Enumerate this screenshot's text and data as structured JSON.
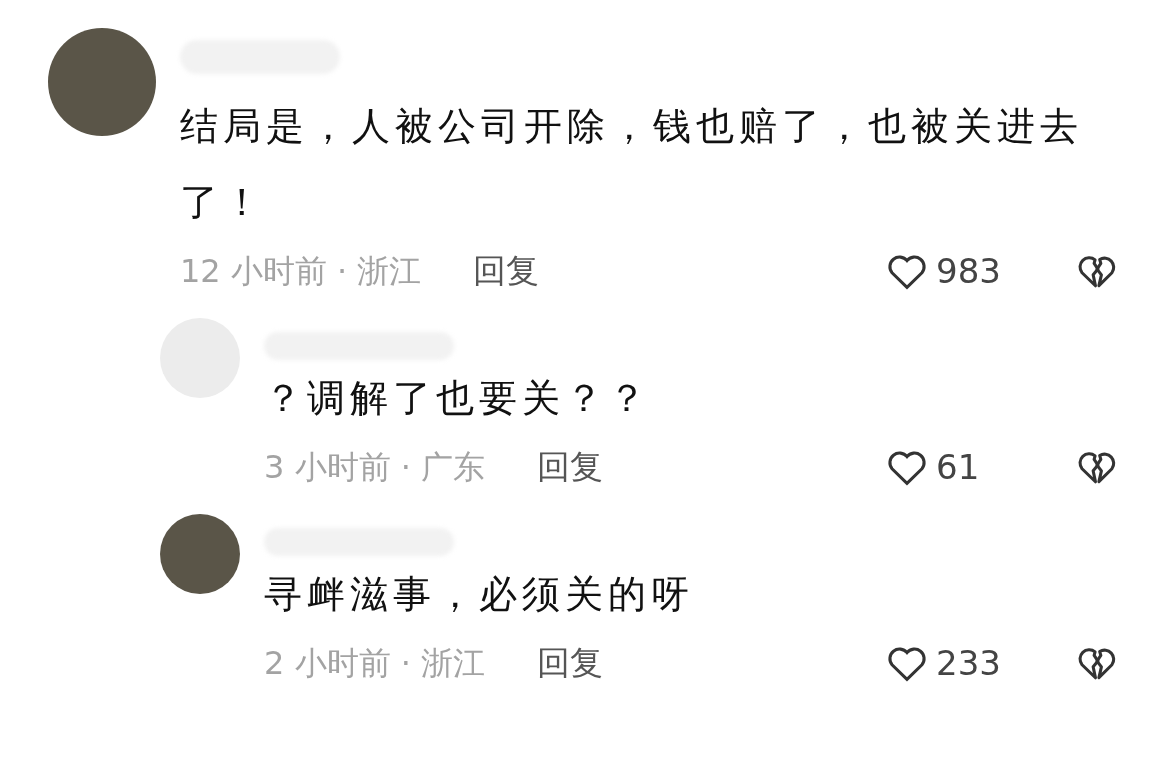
{
  "comments": [
    {
      "text": "结局是，人被公司开除，钱也赔了，也被关进去了！",
      "meta": "12 小时前 · 浙江",
      "reply_label": "回复",
      "likes": "983",
      "replies": [
        {
          "text": "？调解了也要关？？",
          "meta": "3 小时前 · 广东",
          "reply_label": "回复",
          "likes": "61"
        },
        {
          "text": "寻衅滋事，必须关的呀",
          "meta": "2 小时前 · 浙江",
          "reply_label": "回复",
          "likes": "233"
        }
      ]
    }
  ]
}
